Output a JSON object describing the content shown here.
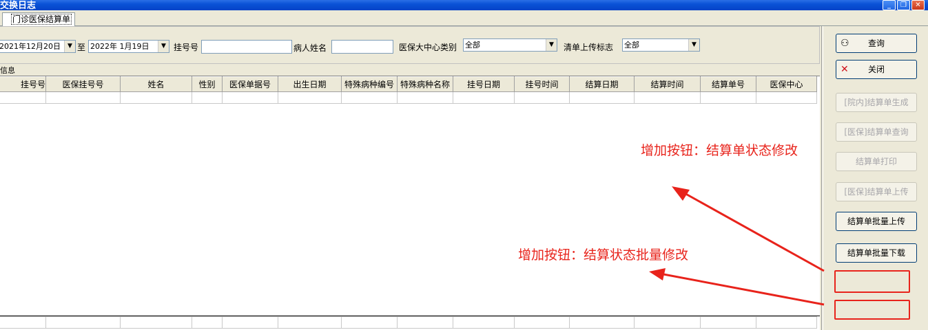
{
  "window": {
    "title": "交换日志"
  },
  "tab": {
    "label": "门诊医保结算单"
  },
  "filters": {
    "date_from": "2021年12月20日",
    "to_label": "至",
    "date_to": "2022年 1月19日",
    "reg_no_label": "挂号号",
    "reg_no_value": "",
    "patient_label": "病人姓名",
    "patient_value": "",
    "center_type_label": "医保大中心类别",
    "center_type_value": "全部",
    "upload_flag_label": "清单上传标志",
    "upload_flag_value": "全部"
  },
  "grid": {
    "group_label": "信息",
    "columns": [
      "挂号号",
      "医保挂号号",
      "姓名",
      "性别",
      "医保单据号",
      "出生日期",
      "特殊病种编号",
      "特殊病种名称",
      "挂号日期",
      "挂号时间",
      "结算日期",
      "结算时间",
      "结算单号",
      "医保中心"
    ]
  },
  "buttons": {
    "query": "查询",
    "close": "关闭",
    "gen_statement": "[院内]结算单生成",
    "query_statement": "[医保]结算单查询",
    "print_statement": "结算单打印",
    "upload_statement": "[医保]结算单上传",
    "batch_upload": "结算单批量上传",
    "batch_download": "结算单批量下载"
  },
  "annotations": {
    "note1": "增加按钮：结算单状态修改",
    "note2": "增加按钮：结算状态批量修改"
  },
  "colors": {
    "annotation": "#e8231b",
    "titlebar": "#0a52d6"
  }
}
